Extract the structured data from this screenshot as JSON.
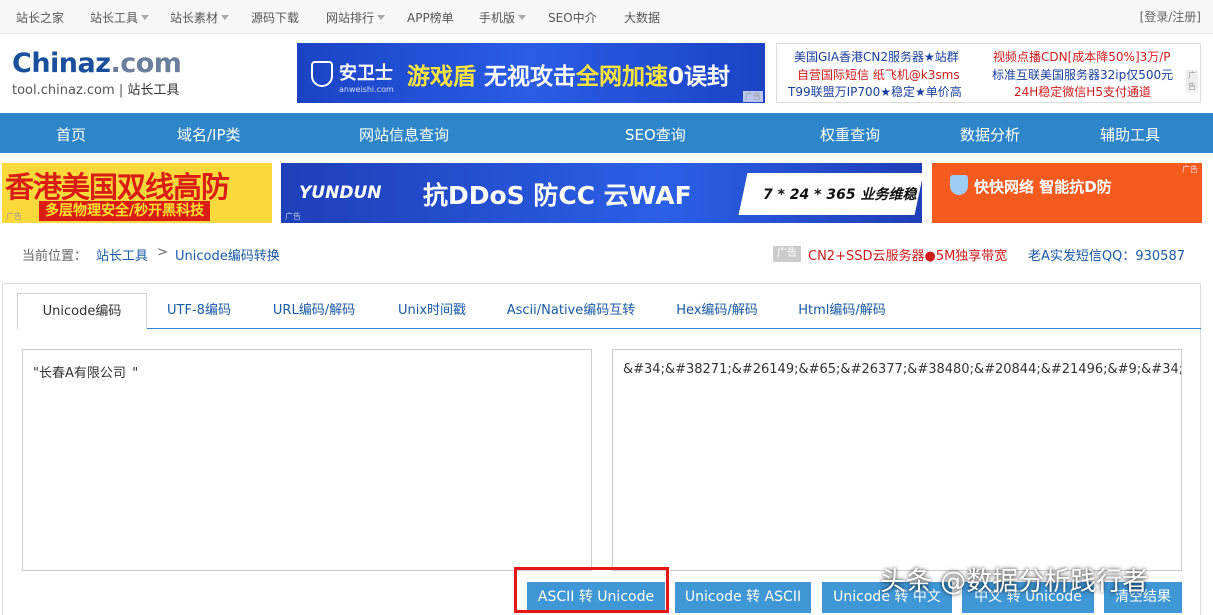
{
  "topnav": {
    "items": [
      "站长之家",
      "站长工具",
      "站长素材",
      "源码下载",
      "网站排行",
      "APP榜单",
      "手机版",
      "SEO中介",
      "大数据"
    ],
    "login": "[登录/注册]"
  },
  "logo": {
    "main_a": "Chinaz",
    "main_b": ".com",
    "domain": "tool.chinaz.com",
    "name": "站长工具"
  },
  "ad_anquan": {
    "brand": "安卫士",
    "brand_en": "anweishi.com",
    "slogan_a": "游戏盾",
    "slogan_b": "无视攻击",
    "slogan_c": "全网加速",
    "slogan_d": "0误封",
    "tag": "广告"
  },
  "ad_text": {
    "l1": "美国GIA香港CN2服务器★站群",
    "l2": "自营国际短信 纸飞机@k3sms",
    "l3": "T99联盟万IP700★稳定★单价高",
    "r1": "视频点播CDN[成本降50%]3万/P",
    "r2": "标准互联美国服务器32ip仅500元",
    "r3": "24H稳定微信H5支付通道",
    "tag": "广告"
  },
  "mainnav": {
    "items": [
      "首页",
      "域名/IP类",
      "网站信息查询",
      "SEO查询",
      "权重查询",
      "数据分析",
      "辅助工具"
    ]
  },
  "banners": {
    "b1_title": "香港美国双线高防",
    "b1_sub": "多层物理安全/秒开黑科技",
    "b2_brand": "YUNDUN",
    "b2_big": "抗DDoS  防CC  云WAF",
    "b2_service": "7 * 24 * 365 业务维稳",
    "b3_text": "快快网络  智能抗D防",
    "tag": "广告"
  },
  "breadcrumb": {
    "prefix": "当前位置：",
    "link": "站长工具",
    "sep": ">",
    "current": "Unicode编码转换",
    "ad_tag": "广告",
    "ad_red": "CN2+SSD云服务器●5M独享带宽",
    "ad_blue": "老A实发短信QQ：930587"
  },
  "tabs": [
    "Unicode编码",
    "UTF-8编码",
    "URL编码/解码",
    "Unix时间戳",
    "Ascii/Native编码互转",
    "Hex编码/解码",
    "Html编码/解码"
  ],
  "input_left": "\"长春A有限公司\t\"",
  "input_right": "&#34;&#38271;&#26149;&#65;&#26377;&#38480;&#20844;&#21496;&#9;&#34;",
  "buttons": [
    "ASCII 转 Unicode",
    "Unicode 转 ASCII",
    "Unicode 转 中文",
    "中文 转 Unicode",
    "清空结果"
  ],
  "watermark": "头条 @数据分析践行者"
}
